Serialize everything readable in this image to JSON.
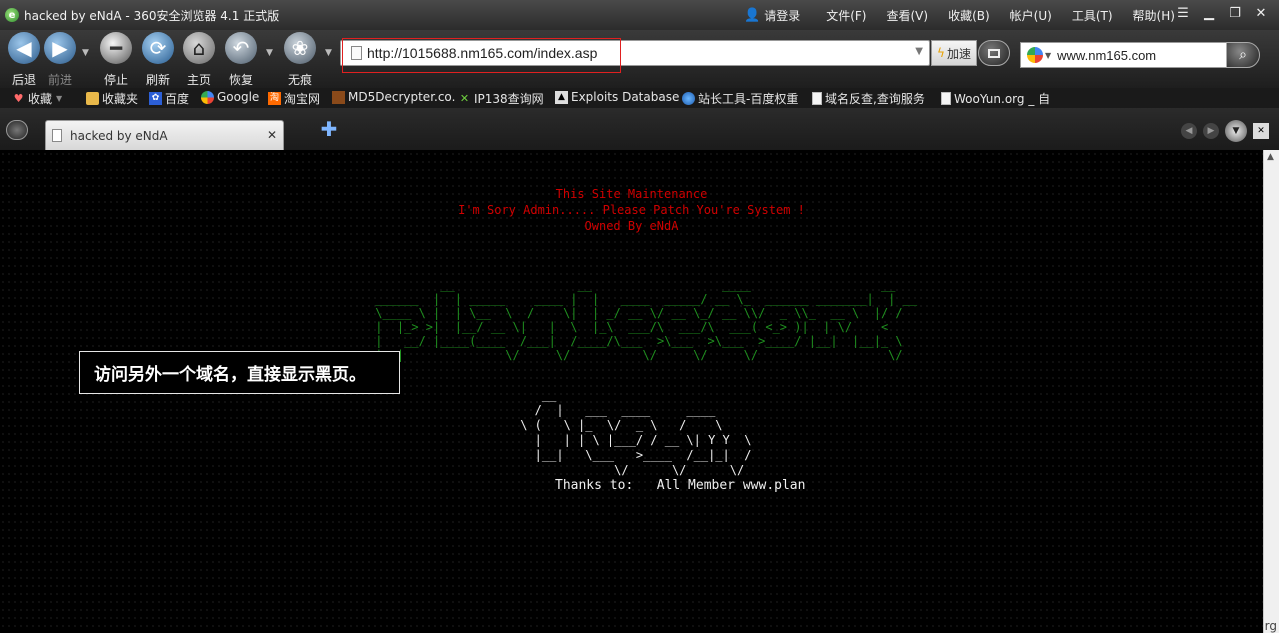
{
  "window": {
    "title": "hacked by eNdA - 360安全浏览器 4.1 正式版",
    "login": "请登录",
    "menu": [
      "文件(F)",
      "查看(V)",
      "收藏(B)",
      "帐户(U)",
      "工具(T)",
      "帮助(H)"
    ]
  },
  "toolbar": {
    "back": "后退",
    "forward": "前进",
    "stop": "停止",
    "refresh": "刷新",
    "home": "主页",
    "restore": "恢复",
    "incognito": "无痕",
    "address": "http://1015688.nm165.com/index.asp",
    "speedup": "加速",
    "search_value": "www.nm165.com"
  },
  "bookmarks": [
    "收藏",
    "收藏夹",
    "百度",
    "Google",
    "淘宝网",
    "MD5Decrypter.co.",
    "IP138查询网",
    "Exploits Database",
    "站长工具-百度权重",
    "域名反查,查询服务",
    "WooYun.org _ 自"
  ],
  "tabs": [
    {
      "label": "hacked by eNdA",
      "active": true
    }
  ],
  "page": {
    "line1": "This Site Maintenance",
    "line2": "I'm Sory Admin..... Please Patch You're System !",
    "line3": "Owned By eNdA",
    "thanks": "Thanks to:   All Member www.plan",
    "callout": "访问另外一个域名，直接显示黑页。",
    "corner": "rg"
  },
  "colors": {
    "message_red": "#d00000",
    "ascii_green": "#1f8f1f",
    "highlight_red": "#e02020"
  }
}
